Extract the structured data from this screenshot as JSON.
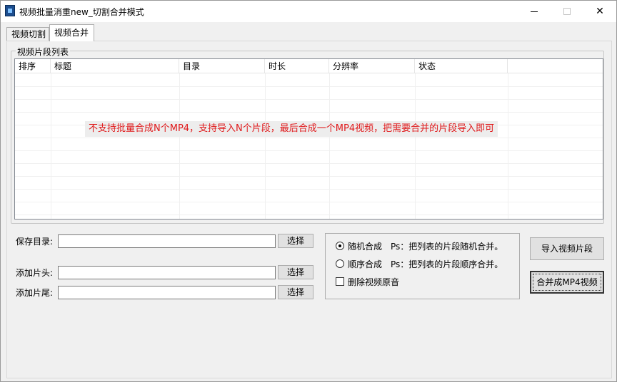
{
  "window": {
    "title": "视频批量消重new_切割合并模式",
    "minimize_icon": "minimize-icon",
    "maximize_icon": "maximize-icon",
    "close_symbol": "✕"
  },
  "tabs": [
    {
      "label": "视频切割",
      "selected": false
    },
    {
      "label": "视频合并",
      "selected": true
    }
  ],
  "clip_list": {
    "group_label": "视频片段列表",
    "columns": [
      "排序",
      "标题",
      "目录",
      "时长",
      "分辨率",
      "状态"
    ],
    "rows": [],
    "notice": "不支持批量合成N个MP4，支持导入N个片段，最后合成一个MP4视频，把需要合并的片段导入即可"
  },
  "save_dir": {
    "label": "保存目录:",
    "value": "",
    "button": "选择"
  },
  "intro": {
    "label": "添加片头:",
    "value": "",
    "button": "选择"
  },
  "outro": {
    "label": "添加片尾:",
    "value": "",
    "button": "选择"
  },
  "options": {
    "random_label": "随机合成",
    "random_note": "Ps：把列表的片段随机合并。",
    "random_selected": true,
    "sequential_label": "顺序合成",
    "sequential_note": "Ps：把列表的片段顺序合并。",
    "sequential_selected": false,
    "remove_audio_label": "删除视频原音",
    "remove_audio_checked": false
  },
  "actions": {
    "import_label": "导入视频片段",
    "merge_label": "合并成MP4视频"
  },
  "colors": {
    "notice_text": "#e0191b",
    "panel_background": "#f0f0f0"
  }
}
